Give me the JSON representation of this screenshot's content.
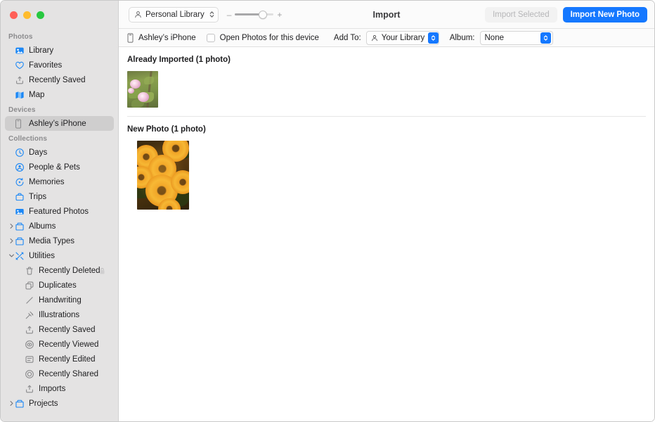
{
  "window": {
    "title": "Import",
    "traffic_lights": [
      "close",
      "minimize",
      "zoom"
    ]
  },
  "toolbar": {
    "library_picker": {
      "label": "Personal Library",
      "icon": "person-icon",
      "stepper_icon": "up-down-chevron-icon"
    },
    "zoom": {
      "minus_label": "–",
      "plus_label": "+",
      "value_percent": 72
    },
    "import_selected_label": "Import Selected",
    "import_selected_enabled": false,
    "import_new_photo_label": "Import New Photo",
    "accent_color": "#1578ff"
  },
  "options_bar": {
    "device_icon": "iphone-icon",
    "device_name": "Ashley’s iPhone",
    "open_photos_checkbox": {
      "label": "Open Photos for this device",
      "checked": false
    },
    "add_to": {
      "label": "Add To:",
      "value": "Your Library",
      "icon": "person-icon"
    },
    "album": {
      "label": "Album:",
      "value": "None"
    }
  },
  "content": {
    "sections": [
      {
        "title": "Already Imported (1 photo)",
        "photos": [
          {
            "name": "pink-geranium-flowers",
            "width": 44,
            "height": 52
          }
        ]
      },
      {
        "title": "New Photo (1 photo)",
        "photos": [
          {
            "name": "orange-rudbeckia-flowers",
            "width": 74,
            "height": 98
          }
        ]
      }
    ]
  },
  "sidebar": {
    "groups": [
      {
        "header": "Photos",
        "items": [
          {
            "label": "Library",
            "icon": "photos-library-icon",
            "tint": "blue",
            "level": 0,
            "selected": false,
            "disclosure": null
          },
          {
            "label": "Favorites",
            "icon": "heart-icon",
            "tint": "blue",
            "level": 0,
            "selected": false,
            "disclosure": null
          },
          {
            "label": "Recently Saved",
            "icon": "tray-arrow-up-icon",
            "tint": "gray",
            "level": 0,
            "selected": false,
            "disclosure": null
          },
          {
            "label": "Map",
            "icon": "map-icon",
            "tint": "blue",
            "level": 0,
            "selected": false,
            "disclosure": null
          }
        ]
      },
      {
        "header": "Devices",
        "items": [
          {
            "label": "Ashley’s iPhone",
            "icon": "iphone-icon",
            "tint": "gray",
            "level": 0,
            "selected": true,
            "disclosure": null
          }
        ]
      },
      {
        "header": "Collections",
        "items": [
          {
            "label": "Days",
            "icon": "clock-icon",
            "tint": "blue",
            "level": 0,
            "selected": false,
            "disclosure": null
          },
          {
            "label": "People & Pets",
            "icon": "person-circle-icon",
            "tint": "blue",
            "level": 0,
            "selected": false,
            "disclosure": null
          },
          {
            "label": "Memories",
            "icon": "memories-play-icon",
            "tint": "blue",
            "level": 0,
            "selected": false,
            "disclosure": null
          },
          {
            "label": "Trips",
            "icon": "suitcase-icon",
            "tint": "blue",
            "level": 0,
            "selected": false,
            "disclosure": null
          },
          {
            "label": "Featured Photos",
            "icon": "featured-photo-icon",
            "tint": "blue",
            "level": 0,
            "selected": false,
            "disclosure": null
          },
          {
            "label": "Albums",
            "icon": "folder-icon",
            "tint": "blue",
            "level": 0,
            "selected": false,
            "disclosure": "collapsed"
          },
          {
            "label": "Media Types",
            "icon": "folder-icon",
            "tint": "blue",
            "level": 0,
            "selected": false,
            "disclosure": "collapsed"
          },
          {
            "label": "Utilities",
            "icon": "wrench-screwdriver-icon",
            "tint": "blue",
            "level": 0,
            "selected": false,
            "disclosure": "expanded"
          },
          {
            "label": "Recently Deleted",
            "icon": "trash-icon",
            "tint": "gray",
            "level": 1,
            "selected": false,
            "disclosure": null,
            "badge": "lock-icon"
          },
          {
            "label": "Duplicates",
            "icon": "duplicates-icon",
            "tint": "gray",
            "level": 1,
            "selected": false,
            "disclosure": null
          },
          {
            "label": "Handwriting",
            "icon": "pencil-line-icon",
            "tint": "gray",
            "level": 1,
            "selected": false,
            "disclosure": null
          },
          {
            "label": "Illustrations",
            "icon": "illustrations-icon",
            "tint": "gray",
            "level": 1,
            "selected": false,
            "disclosure": null
          },
          {
            "label": "Recently Saved",
            "icon": "tray-arrow-up-icon",
            "tint": "gray",
            "level": 1,
            "selected": false,
            "disclosure": null
          },
          {
            "label": "Recently Viewed",
            "icon": "eye-circle-icon",
            "tint": "gray",
            "level": 1,
            "selected": false,
            "disclosure": null
          },
          {
            "label": "Recently Edited",
            "icon": "slider-square-icon",
            "tint": "gray",
            "level": 1,
            "selected": false,
            "disclosure": null
          },
          {
            "label": "Recently Shared",
            "icon": "share-circle-icon",
            "tint": "gray",
            "level": 1,
            "selected": false,
            "disclosure": null
          },
          {
            "label": "Imports",
            "icon": "tray-arrow-up-icon",
            "tint": "gray",
            "level": 1,
            "selected": false,
            "disclosure": null
          },
          {
            "label": "Projects",
            "icon": "folder-icon",
            "tint": "blue",
            "level": 0,
            "selected": false,
            "disclosure": "collapsed"
          }
        ]
      }
    ]
  }
}
